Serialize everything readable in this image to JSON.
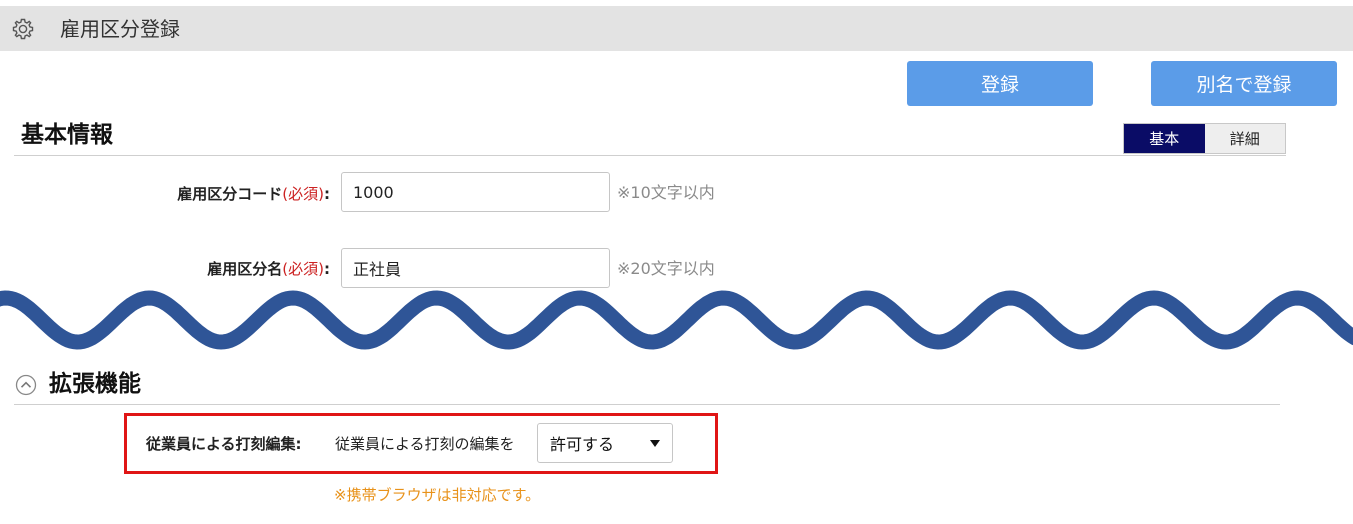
{
  "header": {
    "title": "雇用区分登録",
    "icon": "gear-icon"
  },
  "actions": {
    "register_label": "登録",
    "register_alias_label": "別名で登録",
    "accent_color": "#5b9ce8"
  },
  "basic_section": {
    "title": "基本情報",
    "toggle": {
      "basic_label": "基本",
      "detail_label": "詳細",
      "active": "基本",
      "active_color": "#0a0c66"
    },
    "fields": {
      "code": {
        "label": "雇用区分コード",
        "required_text": "(必須)",
        "colon": ":",
        "value": "1000",
        "hint": "※10文字以内"
      },
      "name": {
        "label": "雇用区分名",
        "required_text": "(必須)",
        "colon": ":",
        "value": "正社員",
        "hint": "※20文字以内"
      }
    }
  },
  "wave_color": "#2f5597",
  "extension_section": {
    "title": "拡張機能",
    "collapse_icon": "chevron-up-circle-icon",
    "punch_edit": {
      "label": "従業員による打刻編集:",
      "description": "従業員による打刻の編集を",
      "selected_value": "許可する",
      "note": "※携帯ブラウザは非対応です。",
      "note_color": "#e8921a",
      "highlight_color": "#e01515"
    }
  }
}
